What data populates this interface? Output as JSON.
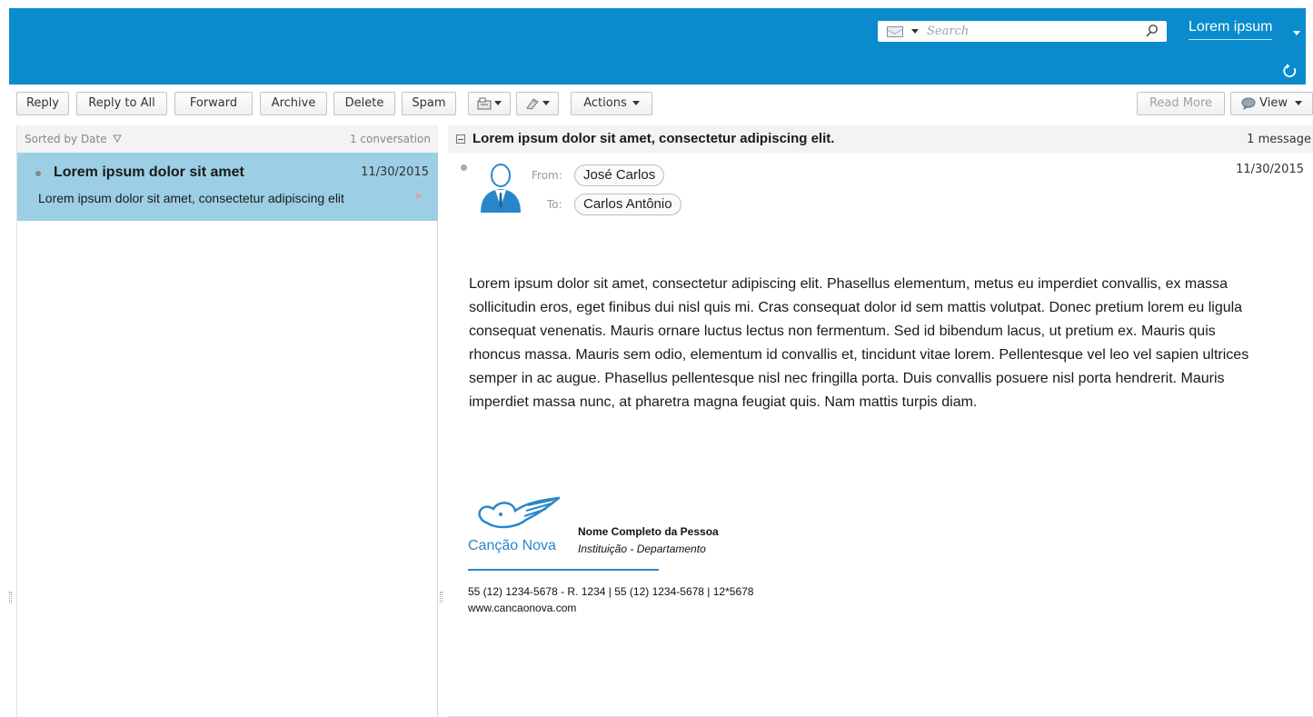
{
  "header": {
    "search_placeholder": "Search",
    "user_name": "Lorem ipsum",
    "icons": [
      "mail-icon",
      "chevron-down-icon",
      "search-icon",
      "refresh-icon"
    ],
    "accent_color": "#0a8bcc"
  },
  "toolbar": {
    "reply": "Reply",
    "reply_all": "Reply to All",
    "forward": "Forward",
    "archive": "Archive",
    "delete": "Delete",
    "spam": "Spam",
    "actions": "Actions",
    "read_more": "Read More",
    "view": "View",
    "icons": [
      "folder-move-icon",
      "tag-icon",
      "speech-bubble-icon"
    ]
  },
  "list": {
    "sort_label": "Sorted by Date",
    "count_label": "1 conversation",
    "items": [
      {
        "subject": "Lorem ipsum dolor sit amet",
        "date": "11/30/2015",
        "snippet": "Lorem ipsum dolor sit amet, consectetur adipiscing elit",
        "selected_color": "#9ccfe5"
      }
    ]
  },
  "reading": {
    "subject": "Lorem ipsum dolor sit amet, consectetur adipiscing elit.",
    "count_label": "1 message",
    "from_label": "From:",
    "from_name": "José Carlos",
    "to_label": "To:",
    "to_name": "Carlos Antônio",
    "date": "11/30/2015",
    "body": "Lorem ipsum dolor sit amet, consectetur adipiscing elit. Phasellus elementum, metus eu imperdiet convallis, ex massa sollicitudin eros, eget finibus dui nisl quis mi. Cras consequat dolor id sem mattis volutpat. Donec pretium lorem eu ligula consequat venenatis. Mauris ornare luctus lectus non fermentum. Sed id bibendum lacus, ut pretium ex. Mauris quis rhoncus massa. Mauris sem odio, elementum id convallis et, tincidunt vitae lorem. Pellentesque vel leo vel sapien ultrices semper in ac augue. Phasellus pellentesque nisl nec fringilla porta. Duis convallis posuere nisl porta hendrerit. Mauris imperdiet massa nunc, at pharetra magna feugiat quis. Nam mattis turpis diam.",
    "signature": {
      "logo_text": "Canção Nova",
      "name": "Nome Completo da Pessoa",
      "department": "Instituição - Departamento",
      "phone": "55 (12) 1234-5678 - R. 1234 | 55 (12) 1234-5678 | 12*5678",
      "website": "www.cancaonova.com",
      "brand_color": "#2a86c9"
    }
  }
}
